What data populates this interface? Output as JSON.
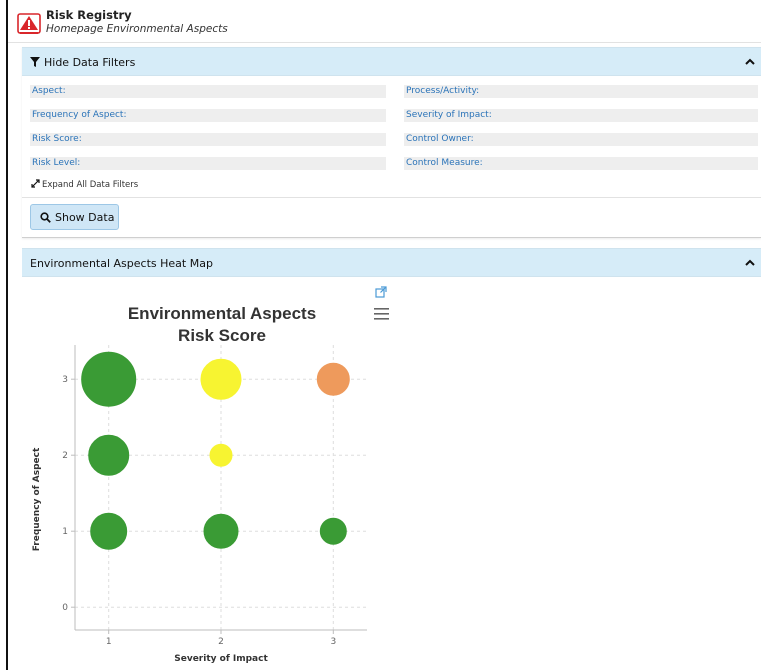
{
  "app": {
    "title": "Risk Registry",
    "subtitle": "Homepage Environmental Aspects",
    "logo_icon": "warning-triangle-icon",
    "brand_color": "#d9262b"
  },
  "filters_panel": {
    "toggle_label": "Hide Data Filters",
    "toggle_icon": "filter-icon",
    "collapse_icon": "chevron-up-icon",
    "left_fields": [
      "Aspect:",
      "Frequency of Aspect:",
      "Risk Score:",
      "Risk Level:"
    ],
    "right_fields": [
      "Process/Activity:",
      "Severity of Impact:",
      "Control Owner:",
      "Control Measure:"
    ],
    "expand_label": "Expand All Data Filters",
    "expand_icon": "expand-arrows-icon",
    "show_button_label": "Show Data",
    "show_button_icon": "search-icon"
  },
  "heatmap_panel": {
    "title": "Environmental Aspects Heat Map",
    "collapse_icon": "chevron-up-icon",
    "popout_icon": "external-link-icon",
    "menu_icon": "hamburger-menu-icon"
  },
  "chart_data": {
    "type": "scatter",
    "title": "Environmental Aspects Risk Score",
    "title_lines": [
      "Environmental Aspects",
      "Risk Score"
    ],
    "xlabel": "Severity of Impact",
    "ylabel": "Frequency of Aspect",
    "x_ticks": [
      "1",
      "2",
      "3"
    ],
    "y_ticks": [
      "0",
      "1",
      "2",
      "3"
    ],
    "xlim": [
      0.7,
      3.3
    ],
    "ylim": [
      -0.3,
      3.45
    ],
    "grid": true,
    "legend": "none",
    "points": [
      {
        "x": 1,
        "y": 3,
        "size": 27,
        "color": "#3a9b35"
      },
      {
        "x": 2,
        "y": 3,
        "size": 20,
        "color": "#f7f431"
      },
      {
        "x": 3,
        "y": 3,
        "size": 16,
        "color": "#ee9a5c"
      },
      {
        "x": 1,
        "y": 2,
        "size": 20,
        "color": "#3a9b35"
      },
      {
        "x": 2,
        "y": 2,
        "size": 11,
        "color": "#f7f431"
      },
      {
        "x": 1,
        "y": 1,
        "size": 18,
        "color": "#3a9b35"
      },
      {
        "x": 2,
        "y": 1,
        "size": 17,
        "color": "#3a9b35"
      },
      {
        "x": 3,
        "y": 1,
        "size": 13,
        "color": "#3a9b35"
      }
    ]
  }
}
